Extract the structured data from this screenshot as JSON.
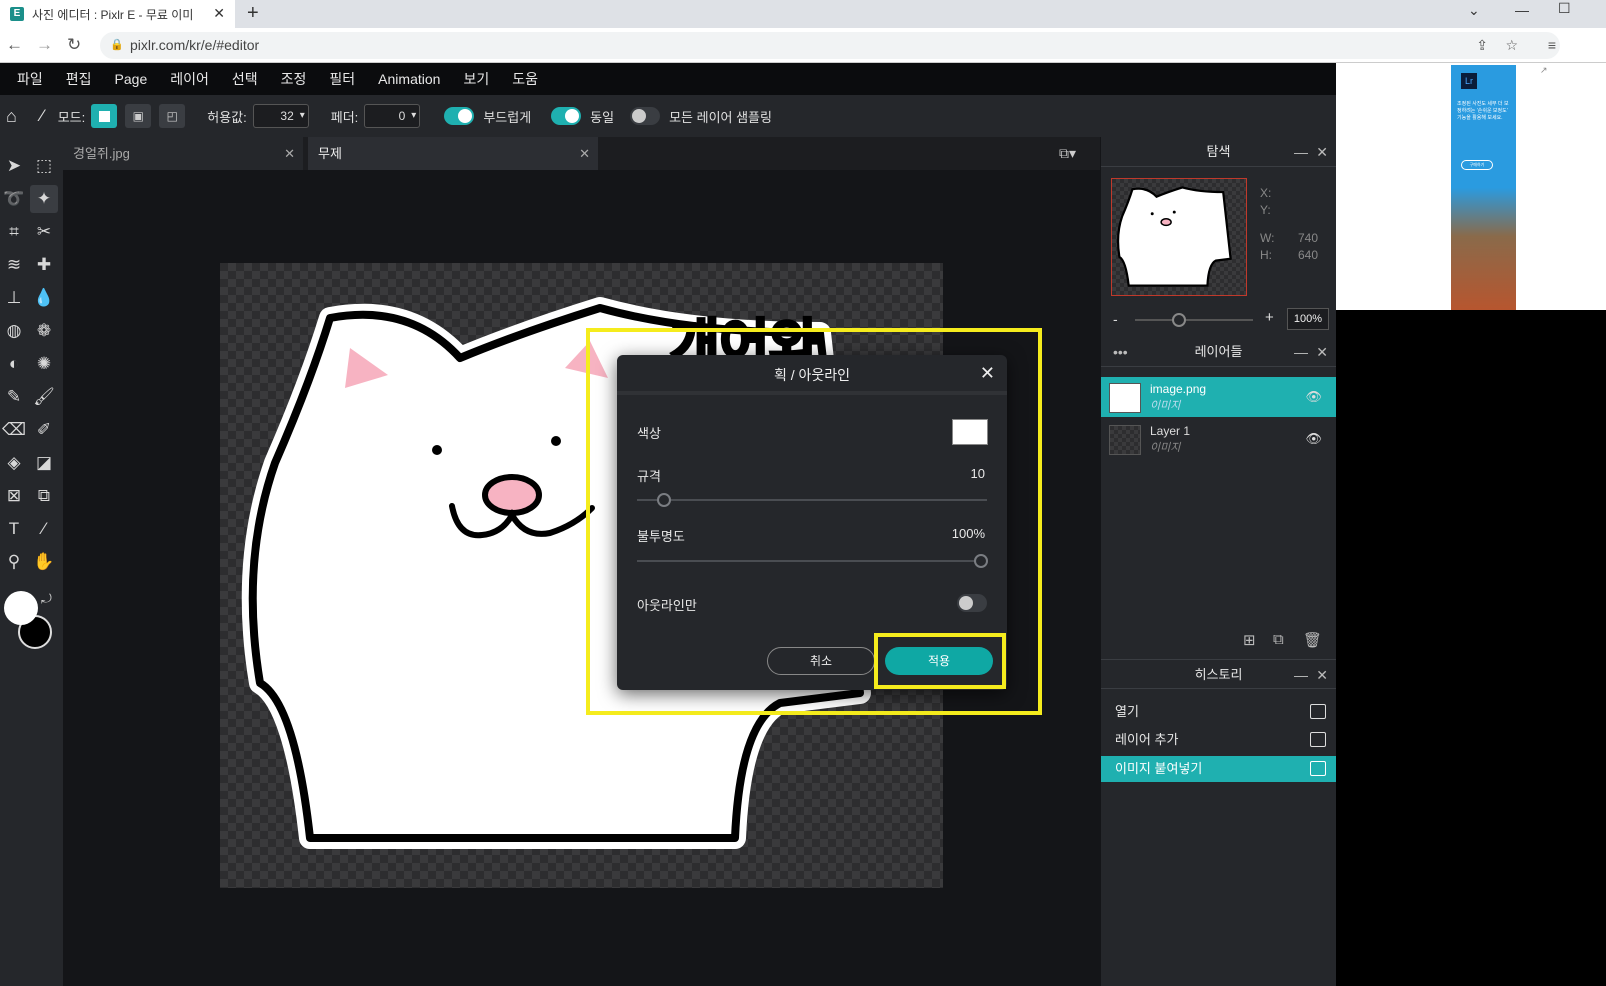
{
  "browser": {
    "tab_title": "사진 에디터 : Pixlr E - 무료 이미",
    "url": "pixlr.com/kr/e/#editor"
  },
  "menu": [
    "파일",
    "편집",
    "Page",
    "레이어",
    "선택",
    "조정",
    "필터",
    "Animation",
    "보기",
    "도움"
  ],
  "options": {
    "mode_label": "모드:",
    "tolerance_label": "허용값:",
    "tolerance_value": "32",
    "feather_label": "페더:",
    "feather_value": "0",
    "smooth_label": "부드럽게",
    "contiguous_label": "동일",
    "sample_all_label": "모든 레이어 샘플링"
  },
  "doc_tabs": [
    {
      "title": "경얼쥐.jpg",
      "active": false
    },
    {
      "title": "무제",
      "active": true
    }
  ],
  "navigator": {
    "title": "탐색",
    "x_label": "X:",
    "y_label": "Y:",
    "w_label": "W:",
    "w_value": "740",
    "h_label": "H:",
    "h_value": "640",
    "zoom": "100%"
  },
  "layers": {
    "title": "레이어들",
    "items": [
      {
        "name": "image.png",
        "type": "이미지",
        "active": true
      },
      {
        "name": "Layer 1",
        "type": "이미지",
        "active": false
      }
    ]
  },
  "history": {
    "title": "히스토리",
    "items": [
      {
        "label": "열기",
        "active": false
      },
      {
        "label": "레이어 추가",
        "active": false
      },
      {
        "label": "이미지 붙여넣기",
        "active": true
      }
    ]
  },
  "dialog": {
    "title": "획 / 아웃라인",
    "color_label": "색상",
    "color_value": "#ffffff",
    "size_label": "규격",
    "size_value": "10",
    "opacity_label": "불투명도",
    "opacity_value": "100%",
    "outline_only_label": "아웃라인만",
    "cancel_label": "취소",
    "apply_label": "적용"
  },
  "ad": {
    "badge": "Lr",
    "text": "조정된 사진도 세부 더 보정하려는 '손쉬운 보정도' 기능을 활용해 보세요.",
    "cta": "구매하기"
  },
  "colors": {
    "accent": "#1fb0b0",
    "highlight": "#f5ec1d"
  }
}
